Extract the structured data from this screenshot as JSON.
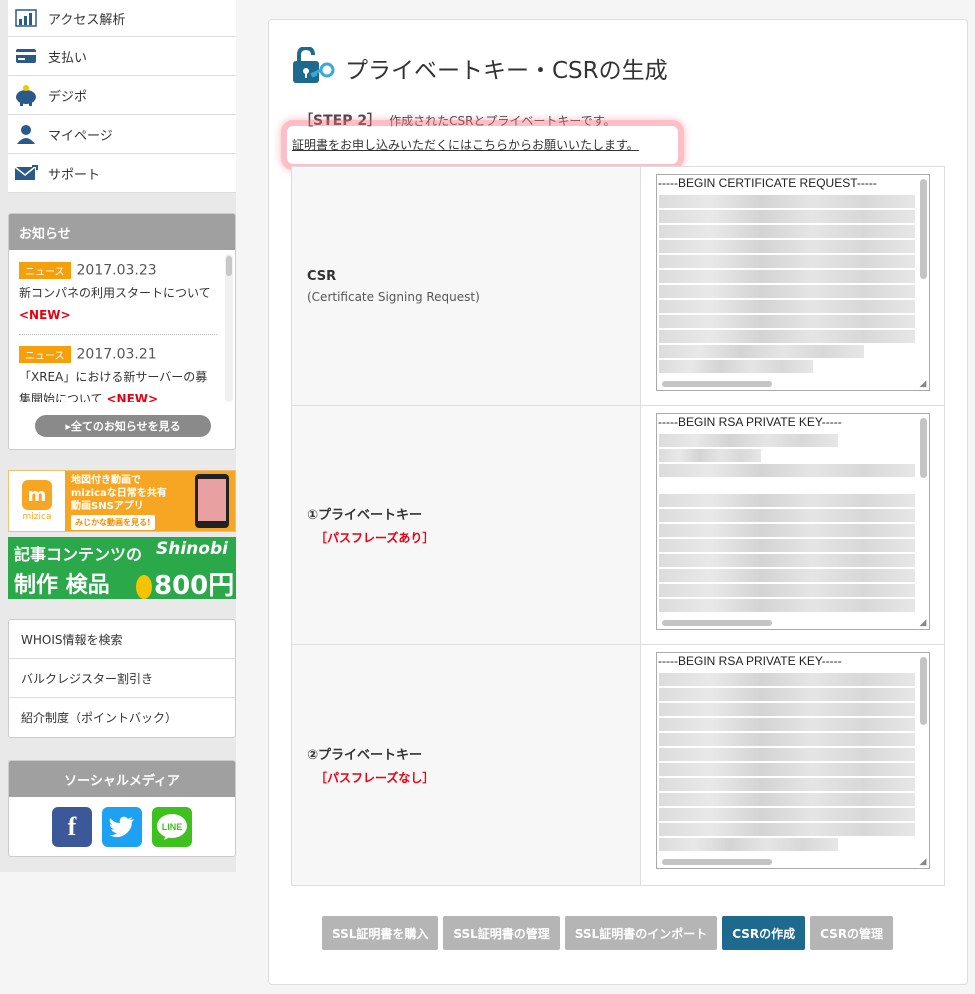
{
  "sidebar": {
    "nav": [
      {
        "label": "アクセス解析",
        "icon": "chart-icon"
      },
      {
        "label": "支払い",
        "icon": "credit-card-icon"
      },
      {
        "label": "デジポ",
        "icon": "piggy-bank-icon"
      },
      {
        "label": "マイページ",
        "icon": "user-icon"
      },
      {
        "label": "サポート",
        "icon": "mail-icon"
      }
    ],
    "news": {
      "title": "お知らせ",
      "items": [
        {
          "badge": "ニュース",
          "date": "2017.03.23",
          "text": "新コンパネの利用スタートについて",
          "new": "<NEW>"
        },
        {
          "badge": "ニュース",
          "date": "2017.03.21",
          "text": "「XREA」における新サーバーの募集開始について",
          "new": "<NEW>"
        }
      ],
      "all_label": "全てのお知らせを見る"
    },
    "banner1": {
      "logo": "mizica",
      "line1": "地図付き動画で",
      "line2": "mizicaな日常を共有",
      "line3": "動画SNSアプリ",
      "button": "みじかな動画を見る!"
    },
    "banner2": {
      "top": "記事コンテンツの",
      "logo": "Shinobi",
      "bottom": "制作 検品",
      "price": "800円"
    },
    "links": [
      "WHOIS情報を検索",
      "バルクレジスター割引き",
      "紹介制度（ポイントバック）"
    ],
    "social": {
      "title": "ソーシャルメディア",
      "fb": "f",
      "line": "LINE"
    }
  },
  "main": {
    "title": "プライベートキー・CSRの生成",
    "step_label": "［STEP 2］",
    "step_text": "作成されたCSRとプライベートキーです。",
    "apply_link": "証明書をお申し込みいただくにはこちらからお願いいたします。",
    "rows": [
      {
        "label": "CSR",
        "sub": "(Certificate Signing Request)",
        "red": "",
        "header": "-----BEGIN CERTIFICATE REQUEST-----"
      },
      {
        "label": "①プライベートキー",
        "sub": "",
        "red": "［パスフレーズあり］",
        "header": "-----BEGIN RSA PRIVATE KEY-----"
      },
      {
        "label": "②プライベートキー",
        "sub": "",
        "red": "［パスフレーズなし］",
        "header": "-----BEGIN RSA PRIVATE KEY-----"
      }
    ],
    "buttons": [
      {
        "label": "SSL証明書を購入",
        "active": false
      },
      {
        "label": "SSL証明書の管理",
        "active": false
      },
      {
        "label": "SSL証明書のインポート",
        "active": false
      },
      {
        "label": "CSRの作成",
        "active": true
      },
      {
        "label": "CSRの管理",
        "active": false
      }
    ]
  },
  "colors": {
    "accent": "#1e6a8e",
    "new_red": "#e60012",
    "badge": "#f5a00b",
    "highlight": "#fa6e82"
  }
}
